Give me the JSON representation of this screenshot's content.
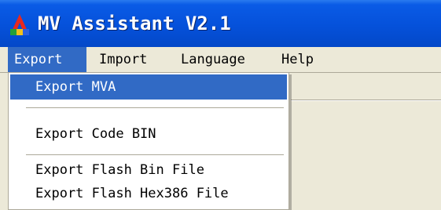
{
  "window": {
    "title": "MV Assistant V2.1",
    "icon": "app-logo-icon"
  },
  "menubar": {
    "items": [
      {
        "label": "Export"
      },
      {
        "label": "Import"
      },
      {
        "label": "Language"
      },
      {
        "label": "Help"
      }
    ]
  },
  "export_menu": {
    "items": [
      {
        "label": "Export MVA"
      },
      {
        "label": "Export Code BIN"
      },
      {
        "label": "Export Flash Bin File"
      },
      {
        "label": "Export Flash Hex386 File"
      }
    ]
  },
  "colors": {
    "titlebar": "#0551DA",
    "highlight": "#316AC5",
    "menubar": "#ECE9D8"
  }
}
